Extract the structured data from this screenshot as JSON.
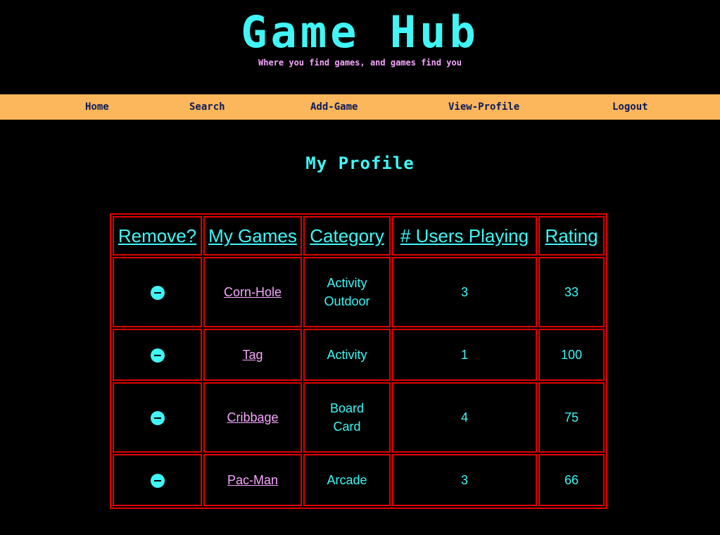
{
  "header": {
    "title": "Game Hub",
    "tagline": "Where you find games, and games find you"
  },
  "nav": [
    {
      "label": "Home"
    },
    {
      "label": "Search"
    },
    {
      "label": "Add-Game"
    },
    {
      "label": "View-Profile"
    },
    {
      "label": "Logout"
    }
  ],
  "page": {
    "title": "My Profile"
  },
  "table": {
    "headers": [
      "Remove?",
      "My Games",
      "Category",
      "# Users Playing",
      "Rating"
    ],
    "rows": [
      {
        "game": "Corn-Hole",
        "category": [
          "Activity",
          "Outdoor"
        ],
        "users": "3",
        "rating": "33"
      },
      {
        "game": "Tag",
        "category": [
          "Activity"
        ],
        "users": "1",
        "rating": "100"
      },
      {
        "game": "Cribbage",
        "category": [
          "Board",
          "Card"
        ],
        "users": "4",
        "rating": "75"
      },
      {
        "game": "Pac-Man",
        "category": [
          "Arcade"
        ],
        "users": "3",
        "rating": "66"
      }
    ]
  },
  "icons": {
    "remove": "minus-circle-icon"
  },
  "colors": {
    "background": "#000000",
    "accent_cyan": "#40f6f6",
    "accent_pink": "#f7a6ff",
    "nav_bar": "#fcb65b",
    "nav_text": "#0a1a5a",
    "table_border": "#e00000"
  }
}
